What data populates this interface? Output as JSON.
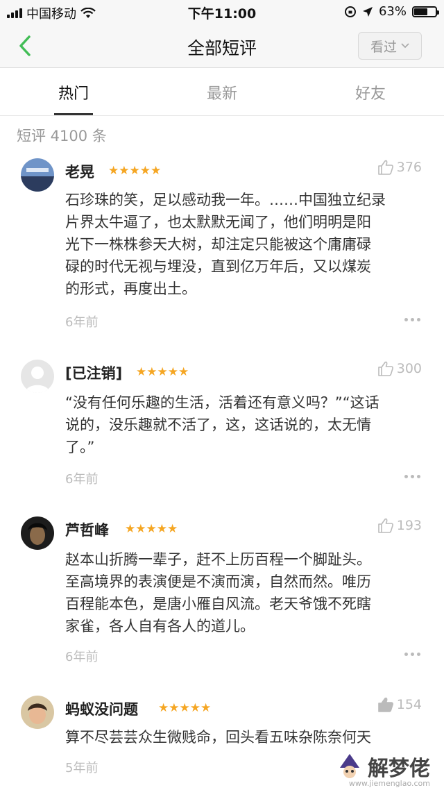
{
  "status_bar": {
    "carrier": "中国移动",
    "time": "下午11:00",
    "battery": "63%",
    "battery_level": 0.63
  },
  "navbar": {
    "title": "全部短评",
    "filter_label": "看过"
  },
  "tabs": [
    {
      "label": "热门",
      "active": true
    },
    {
      "label": "最新",
      "active": false
    },
    {
      "label": "好友",
      "active": false
    }
  ],
  "count_label": "短评 4100 条",
  "reviews": [
    {
      "user": "老晃",
      "rating": 5,
      "stars": "★★★★★",
      "likes": "376",
      "text": [
        "石珍珠的笑，足以感动我一年。……中国独立纪录",
        "片界太牛逼了，也太默默无闻了，他们明明是阳",
        "光下一株株参天大树，却注定只能被这个庸庸碌",
        "碌的时代无视与埋没，直到亿万年后，又以煤炭",
        "的形式，再度出土。"
      ],
      "time": "6年前"
    },
    {
      "user": "[已注销]",
      "rating": 5,
      "stars": "★★★★★",
      "likes": "300",
      "text": [
        "“没有任何乐趣的生活，活着还有意义吗？”“这话",
        "说的，没乐趣就不活了，这，这话说的，太无情",
        "了。”"
      ],
      "time": "6年前"
    },
    {
      "user": "芦哲峰",
      "rating": 5,
      "stars": "★★★★★",
      "likes": "193",
      "text": [
        "赵本山折腾一辈子，赶不上历百程一个脚趾头。",
        "至高境界的表演便是不演而演，自然而然。唯历",
        "百程能本色，是唐小雁自风流。老天爷饿不死瞎",
        "家雀，各人自有各人的道儿。"
      ],
      "time": "6年前"
    },
    {
      "user": "蚂蚁没问题",
      "rating": 5,
      "stars": "★★★★★",
      "likes": "154",
      "text": [
        "算不尽芸芸众生微贱命，回头看五味杂陈奈何天"
      ],
      "time": "5年前"
    }
  ],
  "watermark": {
    "text": "解梦佬",
    "url": "www.jiemenglao.com"
  },
  "colors": {
    "star": "#f5a623",
    "back_arrow": "#42bd56",
    "muted": "#bbbbbb"
  }
}
